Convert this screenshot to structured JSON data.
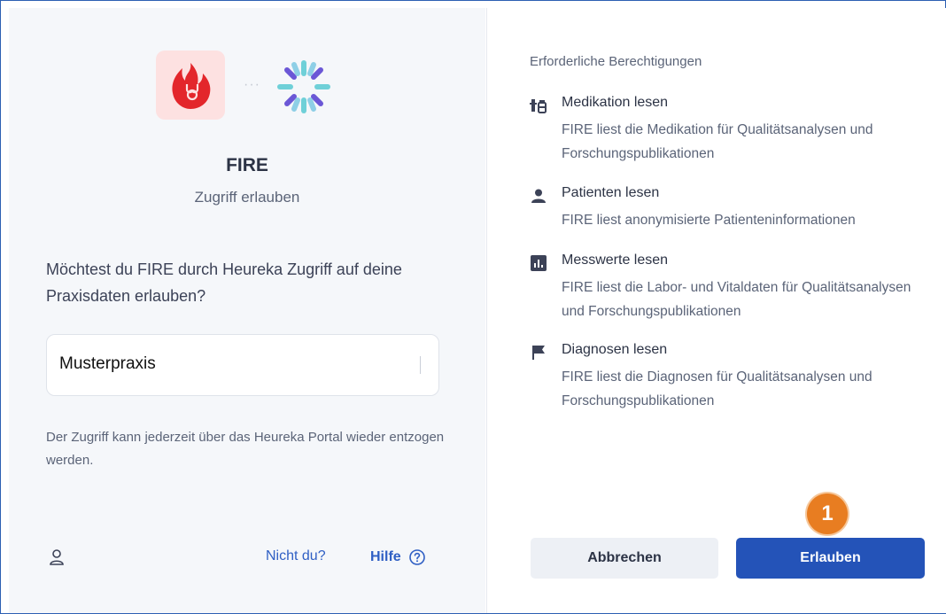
{
  "app": {
    "name": "FIRE",
    "subtitle": "Zugriff erlauben",
    "connector": "···",
    "brand_color": "#e3262b",
    "logo_bg": "#fde1e1"
  },
  "consent": {
    "question": "Möchtest du FIRE durch Heureka Zugriff auf deine Praxisdaten erlauben?",
    "selected_practice": "Musterpraxis",
    "note": "Der Zugriff kann jederzeit über das Heureka Portal wieder entzogen werden."
  },
  "footer": {
    "user_icon": "user-icon",
    "not_you": "Nicht du?",
    "help": "Hilfe",
    "help_icon": "question-circle-icon"
  },
  "permissions": {
    "header": "Erforderliche Berechtigungen",
    "items": [
      {
        "icon": "medication-icon",
        "title": "Medikation lesen",
        "description": "FIRE liest die Medikation für Qualitätsanalysen und Forschungspublikationen"
      },
      {
        "icon": "person-icon",
        "title": "Patienten lesen",
        "description": "FIRE liest anonymisierte Patienteninformationen"
      },
      {
        "icon": "bar-chart-icon",
        "title": "Messwerte lesen",
        "description": "FIRE liest die Labor- und Vitaldaten für Qualitätsanalysen und Forschungspublikationen"
      },
      {
        "icon": "flag-icon",
        "title": "Diagnosen lesen",
        "description": "FIRE liest die Diagnosen für Qualitätsanalysen und Forschungspublikationen"
      }
    ]
  },
  "actions": {
    "cancel": "Abbrechen",
    "allow": "Erlauben",
    "primary_color": "#2453b8"
  },
  "annotation": {
    "step": "1",
    "color": "#e87d21"
  }
}
